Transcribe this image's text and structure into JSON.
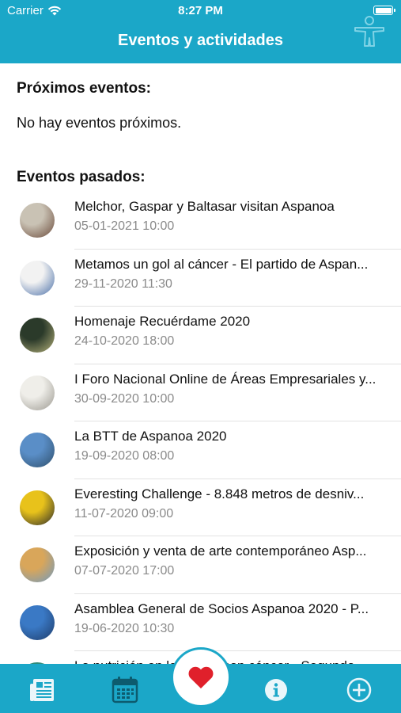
{
  "status_bar": {
    "carrier": "Carrier",
    "time": "8:27 PM"
  },
  "nav": {
    "title": "Eventos y actividades",
    "logo_icon": "child-figure-icon"
  },
  "upcoming": {
    "heading": "Próximos eventos:",
    "empty_text": "No hay eventos próximos."
  },
  "past": {
    "heading": "Eventos pasados:",
    "events": [
      {
        "title": "Melchor, Gaspar y Baltasar visitan Aspanoa",
        "date": "05-01-2021 10:00",
        "thumb_colors": [
          "#c9c2b4",
          "#6b4a3a"
        ]
      },
      {
        "title": "Metamos un gol al cáncer - El partido de Aspan...",
        "date": "29-11-2020 11:30",
        "thumb_colors": [
          "#f2f2f2",
          "#4a6fa8"
        ]
      },
      {
        "title": "Homenaje Recuérdame 2020",
        "date": "24-10-2020 18:00",
        "thumb_colors": [
          "#2b3a2a",
          "#b4b07a"
        ]
      },
      {
        "title": "I Foro Nacional Online de Áreas Empresariales y...",
        "date": "30-09-2020 10:00",
        "thumb_colors": [
          "#efeee9",
          "#9b9890"
        ]
      },
      {
        "title": "La BTT de Aspanoa 2020",
        "date": "19-09-2020 08:00",
        "thumb_colors": [
          "#5a8ec7",
          "#2f4f6b"
        ]
      },
      {
        "title": "Everesting Challenge - 8.848 metros de desniv...",
        "date": "11-07-2020 09:00",
        "thumb_colors": [
          "#e8c21b",
          "#2a2a2a"
        ]
      },
      {
        "title": "Exposición y venta de arte contemporáneo Asp...",
        "date": "07-07-2020 17:00",
        "thumb_colors": [
          "#d9a65a",
          "#6f9ac0"
        ]
      },
      {
        "title": "Asamblea General de Socios Aspanoa 2020 - P...",
        "date": "19-06-2020 10:30",
        "thumb_colors": [
          "#3a79c5",
          "#1e3c6a"
        ]
      },
      {
        "title": "La nutrición en los niños con cáncer - Segundo...",
        "date": "",
        "thumb_colors": [
          "#2f8a7a",
          "#bfe0d9"
        ]
      }
    ]
  },
  "tabbar": {
    "tabs": [
      {
        "icon": "newspaper-icon"
      },
      {
        "icon": "calendar-icon"
      },
      {
        "icon": "info-icon"
      },
      {
        "icon": "add-circle-icon"
      }
    ],
    "center_button_icon": "heart-icon"
  },
  "colors": {
    "brand": "#1ba7c8",
    "heart": "#e0202b",
    "date_text": "#8a8a8a"
  }
}
